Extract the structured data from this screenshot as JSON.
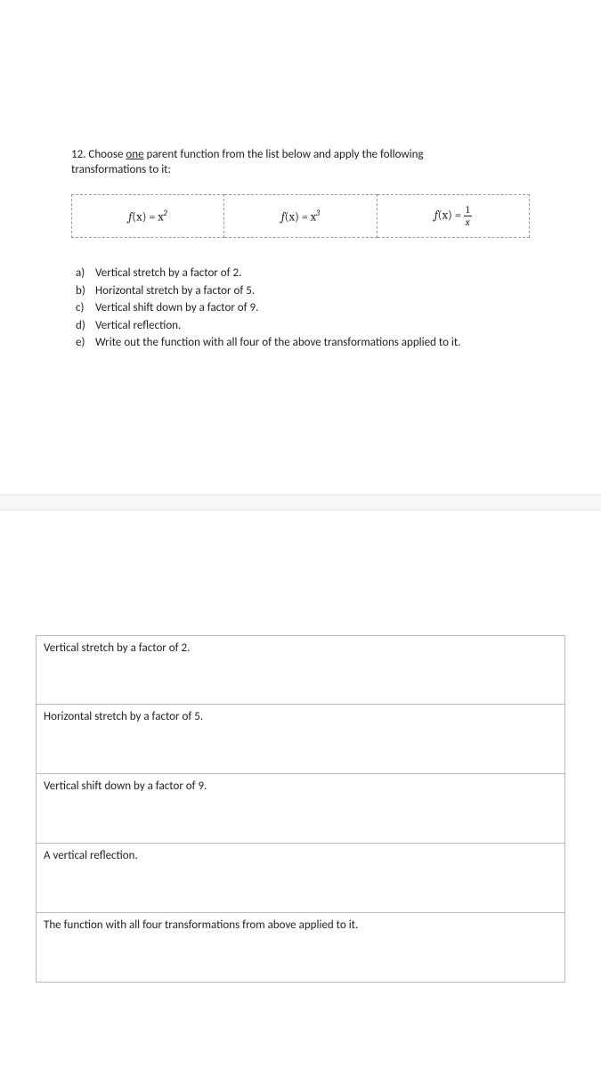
{
  "question": {
    "number": "12",
    "text_prefix": "Choose ",
    "underlined_word": "one",
    "text_suffix": " parent function from the list below and apply the following",
    "text_line2": "transformations to it:"
  },
  "functions": {
    "f1_label": "f",
    "f1_var": "(x) = x",
    "f1_exp": "2",
    "f2_label": "f",
    "f2_var": "(x) = x",
    "f2_exp": "3",
    "f3_label": "f",
    "f3_prefix": "(x) = ",
    "f3_num": "1",
    "f3_den": "x"
  },
  "options": {
    "a_label": "a)",
    "a_text": "Vertical stretch by a factor of 2.",
    "b_label": "b)",
    "b_text": "Horizontal stretch by a factor of 5.",
    "c_label": "c)",
    "c_text": "Vertical shift down by a factor of 9.",
    "d_label": "d)",
    "d_text": "Vertical reflection.",
    "e_label": "e)",
    "e_text": "Write out the function with all four of the above transformations applied to it."
  },
  "answers": {
    "box1": "Vertical stretch by a factor of 2.",
    "box2": "Horizontal stretch by a factor of 5.",
    "box3": "Vertical shift down by a factor of 9.",
    "box4": "A vertical reflection.",
    "box5": "The function with all four transformations from above applied to it."
  }
}
